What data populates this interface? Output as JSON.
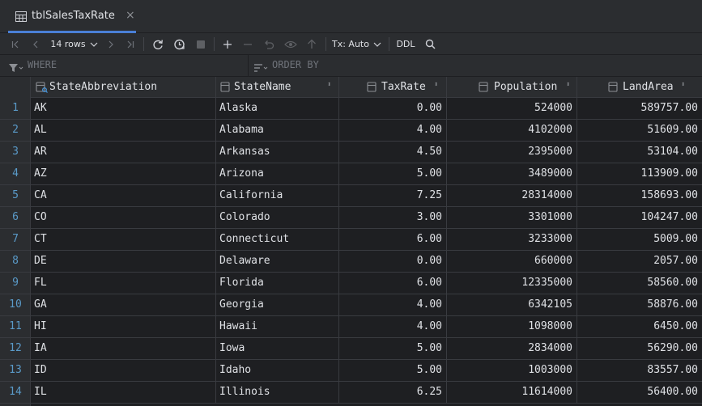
{
  "tab": {
    "title": "tblSalesTaxRate",
    "close": "×"
  },
  "toolbar": {
    "rows_label": "14 rows",
    "tx_label": "Tx: Auto",
    "ddl_label": "DDL"
  },
  "filter": {
    "where_placeholder": "WHERE",
    "order_placeholder": "ORDER BY"
  },
  "columns": [
    "StateAbbreviation",
    "StateName",
    "TaxRate",
    "Population",
    "LandArea"
  ],
  "rows": [
    [
      "1",
      "AK",
      "Alaska",
      "0.00",
      "524000",
      "589757.00"
    ],
    [
      "2",
      "AL",
      "Alabama",
      "4.00",
      "4102000",
      "51609.00"
    ],
    [
      "3",
      "AR",
      "Arkansas",
      "4.50",
      "2395000",
      "53104.00"
    ],
    [
      "4",
      "AZ",
      "Arizona",
      "5.00",
      "3489000",
      "113909.00"
    ],
    [
      "5",
      "CA",
      "California",
      "7.25",
      "28314000",
      "158693.00"
    ],
    [
      "6",
      "CO",
      "Colorado",
      "3.00",
      "3301000",
      "104247.00"
    ],
    [
      "7",
      "CT",
      "Connecticut",
      "6.00",
      "3233000",
      "5009.00"
    ],
    [
      "8",
      "DE",
      "Delaware",
      "0.00",
      "660000",
      "2057.00"
    ],
    [
      "9",
      "FL",
      "Florida",
      "6.00",
      "12335000",
      "58560.00"
    ],
    [
      "10",
      "GA",
      "Georgia",
      "4.00",
      "6342105",
      "58876.00"
    ],
    [
      "11",
      "HI",
      "Hawaii",
      "4.00",
      "1098000",
      "6450.00"
    ],
    [
      "12",
      "IA",
      "Iowa",
      "5.00",
      "2834000",
      "56290.00"
    ],
    [
      "13",
      "ID",
      "Idaho",
      "5.00",
      "1003000",
      "83557.00"
    ],
    [
      "14",
      "IL",
      "Illinois",
      "6.25",
      "11614000",
      "56400.00"
    ]
  ],
  "colors": {
    "accent": "#4a7fd6",
    "rownum": "#5a9ac8",
    "background": "#1e1f22"
  }
}
